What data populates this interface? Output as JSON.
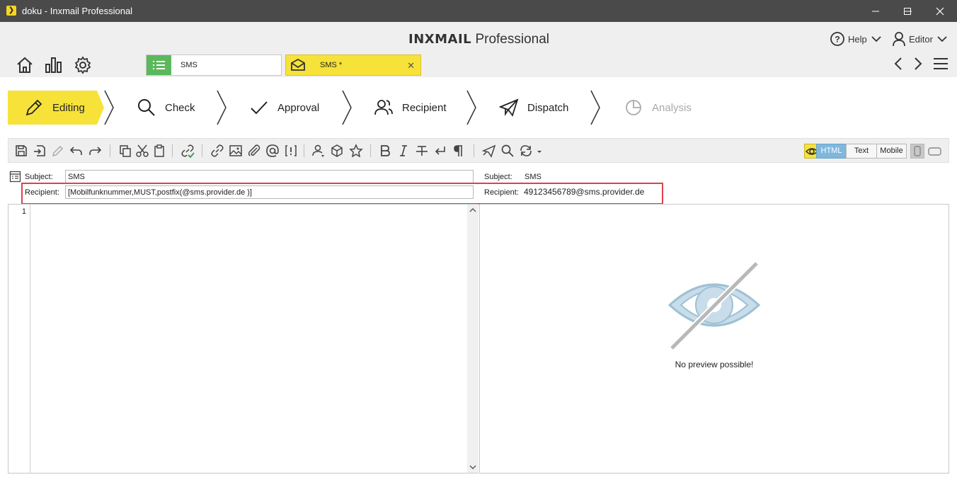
{
  "window": {
    "title": "doku - Inxmail Professional"
  },
  "brand": {
    "name_bold": "INXMAIL",
    "name_rest": "Professional"
  },
  "header": {
    "help_label": "Help",
    "user_label": "Editor"
  },
  "tabs": [
    {
      "label": "SMS",
      "icon": "list-icon"
    },
    {
      "label": "SMS *",
      "icon": "envelope-icon"
    }
  ],
  "workflow": [
    {
      "label": "Editing",
      "state": "active"
    },
    {
      "label": "Check",
      "state": "normal"
    },
    {
      "label": "Approval",
      "state": "normal"
    },
    {
      "label": "Recipient",
      "state": "normal"
    },
    {
      "label": "Dispatch",
      "state": "normal"
    },
    {
      "label": "Analysis",
      "state": "disabled"
    }
  ],
  "view_modes": {
    "html": "HTML",
    "text": "Text",
    "mobile": "Mobile",
    "selected": "HTML"
  },
  "editor": {
    "subject_label": "Subject:",
    "subject_value": "SMS",
    "recipient_label": "Recipient:",
    "recipient_value": "[Mobilfunknummer,MUST,postfix(@sms.provider.de )]",
    "line_number": "1"
  },
  "preview": {
    "subject_label": "Subject:",
    "subject_value": "SMS",
    "recipient_label": "Recipient:",
    "recipient_value": "49123456789@sms.provider.de",
    "empty_message": "No preview possible!"
  },
  "colors": {
    "accent_yellow": "#f7e23a",
    "tab_green": "#5cb85c",
    "highlight_red": "#e0404a",
    "view_selected": "#7fb7dd"
  }
}
